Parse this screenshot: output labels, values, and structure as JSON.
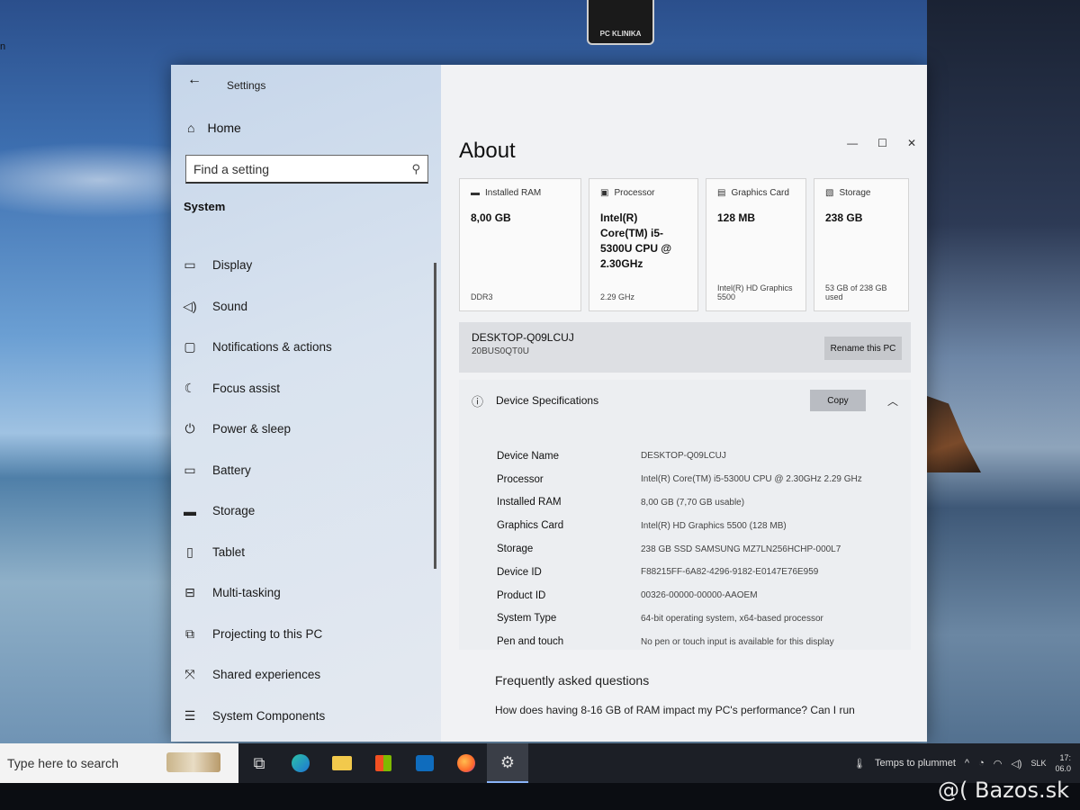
{
  "window": {
    "app_title": "Settings",
    "home_label": "Home",
    "search_placeholder": "Find a setting",
    "section_heading": "System"
  },
  "sidebar": {
    "items": [
      {
        "label": "Display",
        "icon": "monitor-icon"
      },
      {
        "label": "Sound",
        "icon": "speaker-icon"
      },
      {
        "label": "Notifications & actions",
        "icon": "notification-icon"
      },
      {
        "label": "Focus assist",
        "icon": "moon-icon"
      },
      {
        "label": "Power & sleep",
        "icon": "power-icon"
      },
      {
        "label": "Battery",
        "icon": "battery-icon"
      },
      {
        "label": "Storage",
        "icon": "storage-icon"
      },
      {
        "label": "Tablet",
        "icon": "tablet-icon"
      },
      {
        "label": "Multi-tasking",
        "icon": "multitasking-icon"
      },
      {
        "label": "Projecting to this PC",
        "icon": "projecting-icon"
      },
      {
        "label": "Shared experiences",
        "icon": "shared-icon"
      },
      {
        "label": "System Components",
        "icon": "components-icon"
      }
    ]
  },
  "about": {
    "title": "About",
    "cards": [
      {
        "label": "Installed RAM",
        "value": "8,00 GB",
        "sub": "DDR3",
        "icon": "ram-icon"
      },
      {
        "label": "Processor",
        "value": "Intel(R) Core(TM) i5-5300U CPU @ 2.30GHz",
        "sub": "2.29 GHz",
        "icon": "processor-icon"
      },
      {
        "label": "Graphics Card",
        "value": "128 MB",
        "sub": "Intel(R) HD Graphics 5500",
        "icon": "graphics-card-icon"
      },
      {
        "label": "Storage",
        "value": "238 GB",
        "sub": "53 GB of 238 GB used",
        "icon": "storage-card-icon"
      }
    ],
    "pc_name": "DESKTOP-Q09LCUJ",
    "pc_model": "20BUS0QT0U",
    "rename_label": "Rename this PC",
    "specs_title": "Device Specifications",
    "copy_label": "Copy",
    "specs": [
      {
        "key": "Device Name",
        "value": "DESKTOP-Q09LCUJ"
      },
      {
        "key": "Processor",
        "value": "Intel(R) Core(TM) i5-5300U CPU @ 2.30GHz   2.29 GHz"
      },
      {
        "key": "Installed RAM",
        "value": "8,00 GB (7,70 GB usable)"
      },
      {
        "key": "Graphics Card",
        "value": "Intel(R) HD Graphics 5500 (128 MB)"
      },
      {
        "key": "Storage",
        "value": "238 GB SSD SAMSUNG MZ7LN256HCHP-000L7"
      },
      {
        "key": "Device ID",
        "value": "F88215FF-6A82-4296-9182-E0147E76E959"
      },
      {
        "key": "Product ID",
        "value": "00326-00000-00000-AAOEM"
      },
      {
        "key": "System Type",
        "value": "64-bit operating system, x64-based processor"
      },
      {
        "key": "Pen and touch",
        "value": "No pen or touch input is available for this display"
      }
    ],
    "faq_title": "Frequently asked questions",
    "faq_question": "How does having 8-16 GB of RAM impact my PC's performance? Can I run"
  },
  "taskbar": {
    "search_placeholder": "Type here to search",
    "weather": "Temps to plummet",
    "language": "SLK",
    "clock_time": "17:",
    "clock_date": "06.0"
  },
  "background": {
    "top_logo_text": "PC KLINIKA",
    "watermark": "@( Bazos.sk",
    "corner_letter": "n"
  }
}
